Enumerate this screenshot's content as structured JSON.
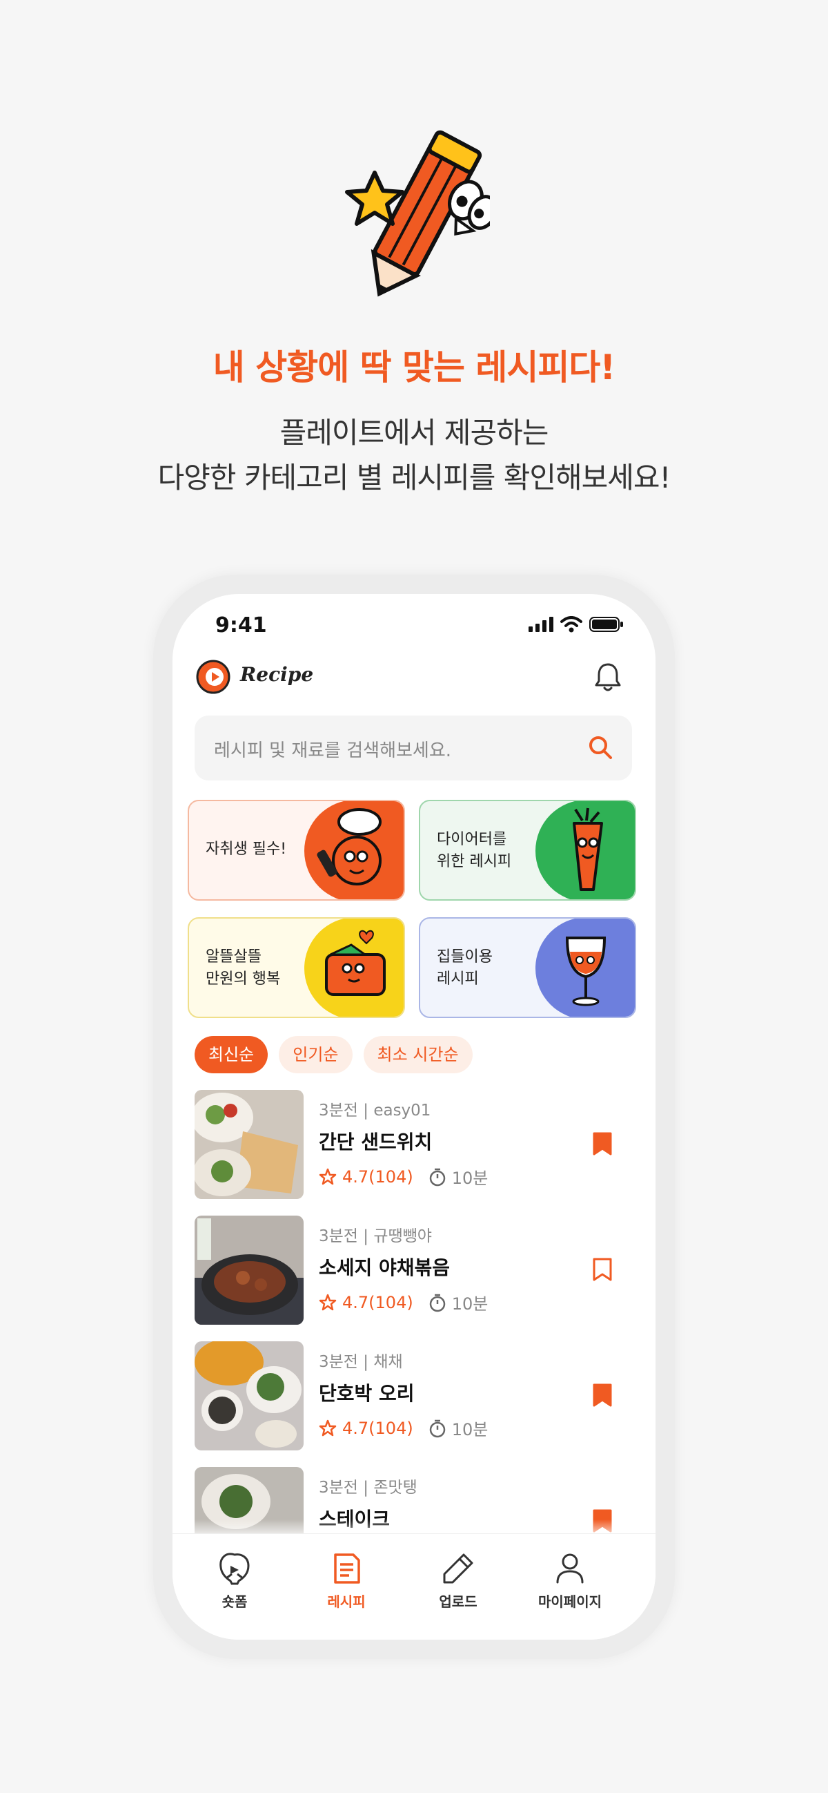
{
  "hero": {
    "headline": "내 상황에 딱 맞는 레시피다!",
    "sub_line1": "플레이트에서 제공하는",
    "sub_line2": "다양한 카테고리 별 레시피를 확인해보세요!"
  },
  "status": {
    "time": "9:41"
  },
  "header": {
    "app_name": "Recipe"
  },
  "search": {
    "placeholder": "레시피 및 재료를 검색해보세요."
  },
  "categories": [
    {
      "line1": "자취생 필수!",
      "line2": "",
      "bg": "#fff4f0",
      "border": "#f5b9a0",
      "accent": "#f05a22"
    },
    {
      "line1": "다이어터를",
      "line2": "위한 레시피",
      "bg": "#eef7f0",
      "border": "#9fd6ac",
      "accent": "#2fb155"
    },
    {
      "line1": "알뜰살뜰",
      "line2": "만원의 행복",
      "bg": "#fffbe8",
      "border": "#f0df8a",
      "accent": "#f7d31a"
    },
    {
      "line1": "집들이용",
      "line2": "레시피",
      "bg": "#f1f4fc",
      "border": "#aab6e6",
      "accent": "#6d7fdd"
    }
  ],
  "sort_chips": [
    {
      "label": "최신순",
      "active": true
    },
    {
      "label": "인기순",
      "active": false
    },
    {
      "label": "최소 시간순",
      "active": false
    }
  ],
  "recipes": [
    {
      "meta": "3분전  |  easy01",
      "title": "간단 샌드위치",
      "rating": "4.7(104)",
      "time": "10분",
      "bookmarked": true
    },
    {
      "meta": "3분전  |  규땡뺑야",
      "title": "소세지 야채볶음",
      "rating": "4.7(104)",
      "time": "10분",
      "bookmarked": false
    },
    {
      "meta": "3분전  |  채채",
      "title": "단호박 오리",
      "rating": "4.7(104)",
      "time": "10분",
      "bookmarked": true
    },
    {
      "meta": "3분전  |  존맛탱",
      "title": "스테이크",
      "rating": "",
      "time": "",
      "bookmarked": true
    }
  ],
  "tabs": [
    {
      "label": "숏폼",
      "icon": "shortform-icon",
      "active": false
    },
    {
      "label": "레시피",
      "icon": "recipe-doc-icon",
      "active": true
    },
    {
      "label": "업로드",
      "icon": "pencil-icon",
      "active": false
    },
    {
      "label": "마이페이지",
      "icon": "person-icon",
      "active": false
    }
  ],
  "colors": {
    "accent": "#f05a22"
  }
}
